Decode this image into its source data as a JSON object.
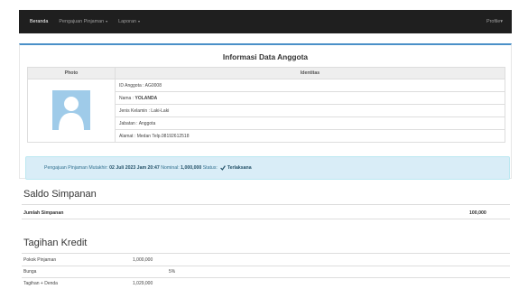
{
  "navbar": {
    "items": [
      {
        "label": "Beranda"
      },
      {
        "label": "Pengajuan Pinjaman"
      },
      {
        "label": "Laporan"
      }
    ],
    "profile_label": "Profile",
    "caret": "▾"
  },
  "panel": {
    "title": "Informasi Data Anggota",
    "headers": {
      "photo": "Photo",
      "identity": "Identitas"
    },
    "rows": [
      {
        "label": "ID Anggota : ",
        "value": "AG0008"
      },
      {
        "label": "Nama : ",
        "value": "YOLANDA"
      },
      {
        "label": "Jenis Kelamin : ",
        "value": "Laki-Laki"
      },
      {
        "label": "Jabatan : ",
        "value": "Anggota"
      },
      {
        "label": "Alamat : ",
        "value": "Medan Telp.08192612518"
      }
    ]
  },
  "alert": {
    "prefix": "Pengajuan Pinjaman Mutakhir:",
    "date": "02 Juli 2023 Jam 20:47",
    "nominal_label": "Nominal:",
    "nominal": "1,000,000",
    "status_label": "Status:",
    "status": "Terlaksana"
  },
  "saldo": {
    "title": "Saldo Simpanan",
    "label": "Jumlah Simpanan",
    "value": "100,000"
  },
  "tagihan": {
    "title": "Tagihan Kredit",
    "rows": [
      {
        "label": "Pokok Pinjaman",
        "value": "1,000,000"
      },
      {
        "label": "Bunga",
        "value": "5%"
      },
      {
        "label": "Tagihan + Denda",
        "value": "1,029,000"
      }
    ]
  },
  "colors": {
    "navbar": "#1f1f1f",
    "panel_accent": "#4a90c8",
    "alert_bg": "#d9edf7",
    "avatar_bg": "#9fcbe9"
  }
}
